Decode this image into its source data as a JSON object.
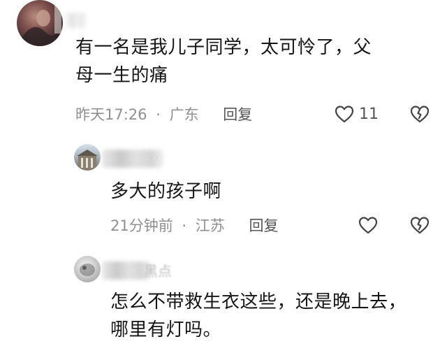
{
  "comments": [
    {
      "text_line1": "有一名是我儿子同学，太可怜了，父",
      "text_line2": "母一生的痛",
      "time": "昨天17:26",
      "separator": "·",
      "location": "广东",
      "reply_label": "回复",
      "likes": "11"
    },
    {
      "username_partial": "· ·",
      "text_line1": "多大的孩子啊",
      "time": "21分钟前",
      "separator": "·",
      "location": "江苏",
      "reply_label": "回复"
    },
    {
      "username_partial": "黑点",
      "text_line1": "怎么不带救生衣这些，还是晚上去，",
      "text_line2": "哪里有灯吗。"
    }
  ],
  "icons": {
    "like": "heart-outline-icon",
    "dislike": "broken-heart-icon"
  },
  "colors": {
    "text": "#151515",
    "meta": "#8f8f8f",
    "reply": "#555555",
    "icon": "#444444"
  }
}
